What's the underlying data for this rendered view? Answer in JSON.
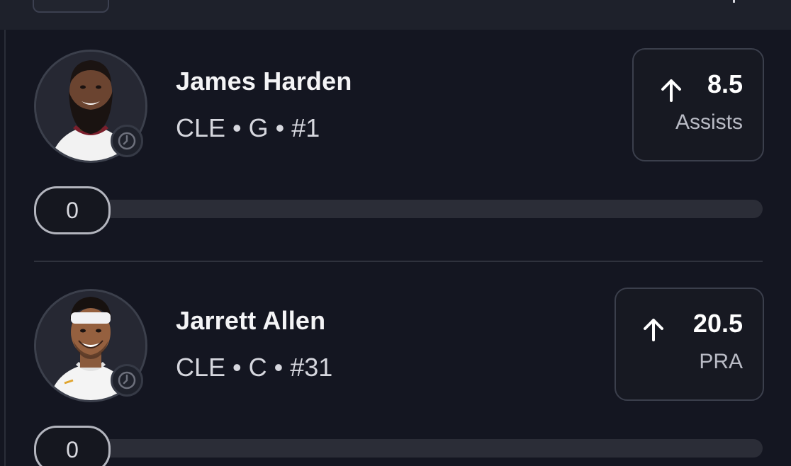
{
  "players": [
    {
      "name": "James Harden",
      "meta": "CLE • G • #1",
      "line": "8.5",
      "stat": "Assists",
      "direction": "over",
      "progress_value": "0",
      "progress_fraction": 0
    },
    {
      "name": "Jarrett Allen",
      "meta": "CLE • C • #31",
      "line": "20.5",
      "stat": "PRA",
      "direction": "over",
      "progress_value": "0",
      "progress_fraction": 0
    }
  ],
  "colors": {
    "background": "#141621",
    "card_border": "#3b3f4c",
    "track": "#2b2d37",
    "text_primary": "#f4f4f6",
    "text_secondary": "#b9bbc5"
  },
  "icons": {
    "direction": "arrow-up-icon",
    "pending": "clock-icon"
  }
}
